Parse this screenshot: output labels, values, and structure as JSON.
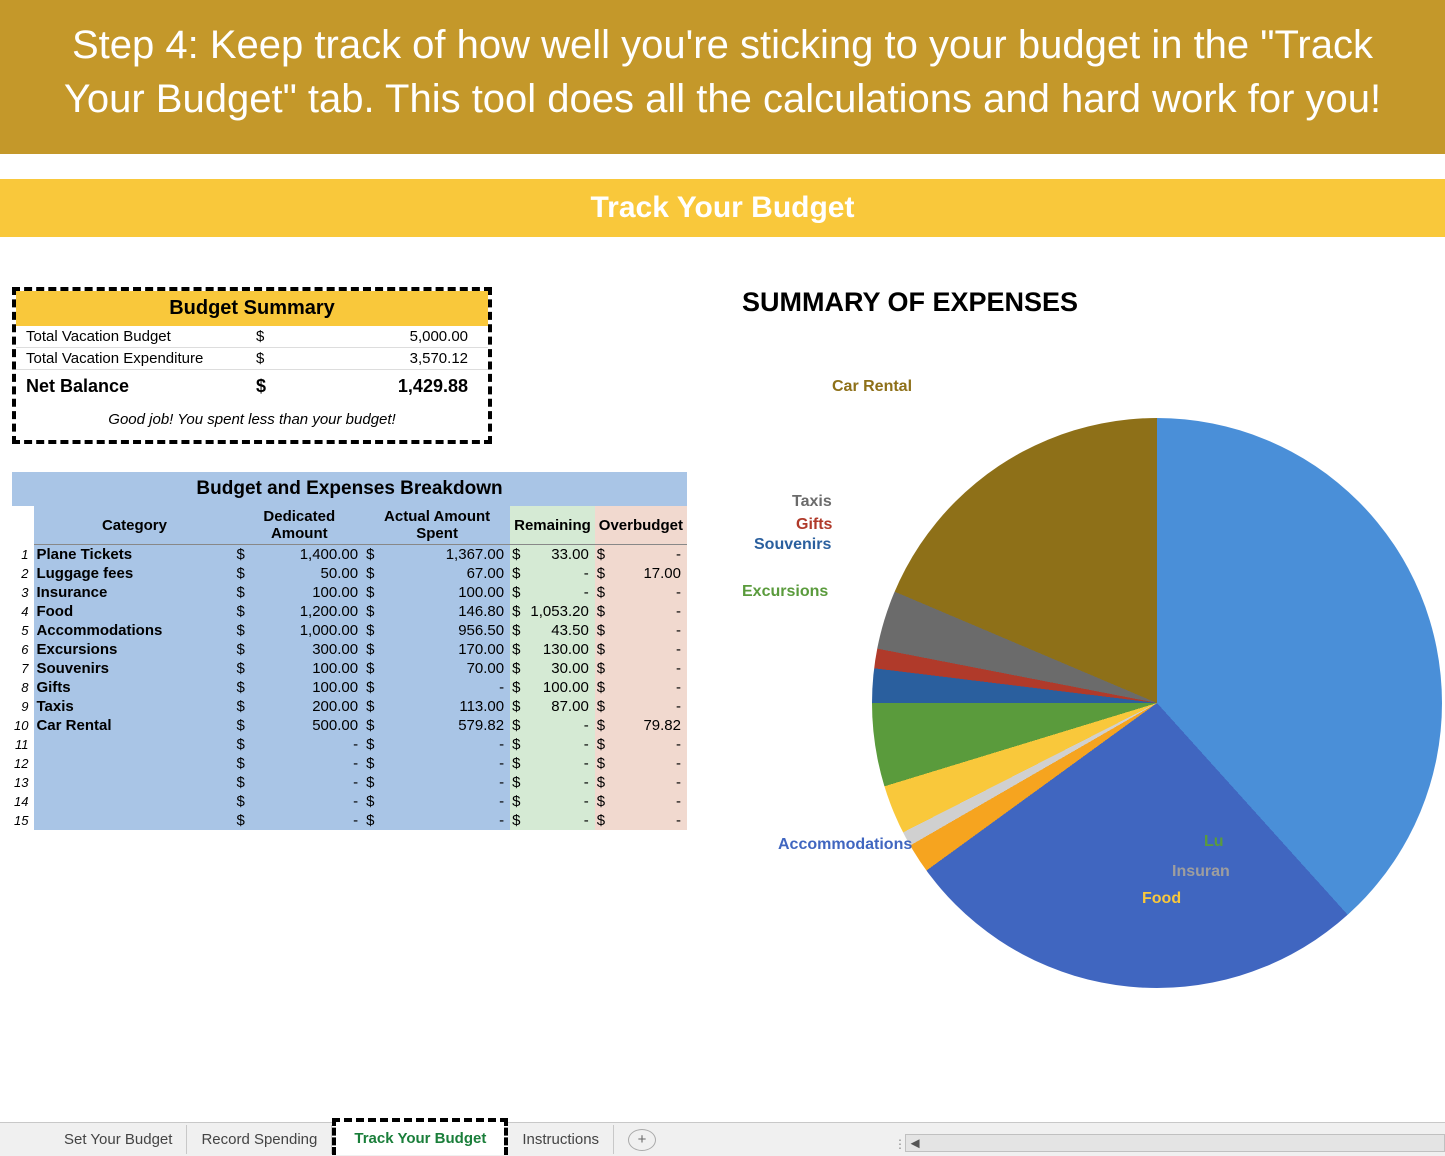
{
  "banner": "Step 4: Keep track of how well you're sticking to your budget in the \"Track Your Budget\" tab. This tool does all the calculations and hard work for you!",
  "title": "Track Your Budget",
  "summary": {
    "header": "Budget Summary",
    "rows": [
      {
        "label": "Total Vacation Budget",
        "cur": "$",
        "value": "5,000.00"
      },
      {
        "label": "Total Vacation Expenditure",
        "cur": "$",
        "value": "3,570.12"
      }
    ],
    "net": {
      "label": "Net Balance",
      "cur": "$",
      "value": "1,429.88"
    },
    "message": "Good job! You spent less than your budget!"
  },
  "breakdown": {
    "title": "Budget and Expenses Breakdown",
    "headers": {
      "category": "Category",
      "dedicated": "Dedicated Amount",
      "actual": "Actual Amount Spent",
      "remaining": "Remaining",
      "overbudget": "Overbudget"
    },
    "rows": [
      {
        "n": "1",
        "cat": "Plane Tickets",
        "ded": "1,400.00",
        "act": "1,367.00",
        "rem": "33.00",
        "over": "-"
      },
      {
        "n": "2",
        "cat": "Luggage fees",
        "ded": "50.00",
        "act": "67.00",
        "rem": "-",
        "over": "17.00"
      },
      {
        "n": "3",
        "cat": "Insurance",
        "ded": "100.00",
        "act": "100.00",
        "rem": "-",
        "over": "-"
      },
      {
        "n": "4",
        "cat": "Food",
        "ded": "1,200.00",
        "act": "146.80",
        "rem": "1,053.20",
        "over": "-"
      },
      {
        "n": "5",
        "cat": "Accommodations",
        "ded": "1,000.00",
        "act": "956.50",
        "rem": "43.50",
        "over": "-"
      },
      {
        "n": "6",
        "cat": "Excursions",
        "ded": "300.00",
        "act": "170.00",
        "rem": "130.00",
        "over": "-"
      },
      {
        "n": "7",
        "cat": "Souvenirs",
        "ded": "100.00",
        "act": "70.00",
        "rem": "30.00",
        "over": "-"
      },
      {
        "n": "8",
        "cat": "Gifts",
        "ded": "100.00",
        "act": "-",
        "rem": "100.00",
        "over": "-"
      },
      {
        "n": "9",
        "cat": "Taxis",
        "ded": "200.00",
        "act": "113.00",
        "rem": "87.00",
        "over": "-"
      },
      {
        "n": "10",
        "cat": "Car Rental",
        "ded": "500.00",
        "act": "579.82",
        "rem": "-",
        "over": "79.82"
      },
      {
        "n": "11",
        "cat": "",
        "ded": "-",
        "act": "-",
        "rem": "-",
        "over": "-"
      },
      {
        "n": "12",
        "cat": "",
        "ded": "-",
        "act": "-",
        "rem": "-",
        "over": "-"
      },
      {
        "n": "13",
        "cat": "",
        "ded": "-",
        "act": "-",
        "rem": "-",
        "over": "-"
      },
      {
        "n": "14",
        "cat": "",
        "ded": "-",
        "act": "-",
        "rem": "-",
        "over": "-"
      },
      {
        "n": "15",
        "cat": "",
        "ded": "-",
        "act": "-",
        "rem": "-",
        "over": "-"
      }
    ]
  },
  "chart": {
    "title": "SUMMARY OF EXPENSES",
    "labels": {
      "carRental": "Car Rental",
      "taxis": "Taxis",
      "gifts": "Gifts",
      "souvenirs": "Souvenirs",
      "excursions": "Excursions",
      "accommodations": "Accommodations",
      "food": "Food",
      "insurance": "Insuran",
      "luggage": "Lu"
    }
  },
  "tabs": {
    "set": "Set Your Budget",
    "record": "Record Spending",
    "track": "Track Your Budget",
    "instructions": "Instructions",
    "plus": "+"
  },
  "chart_data": {
    "type": "pie",
    "title": "SUMMARY OF EXPENSES",
    "series": [
      {
        "name": "Plane Tickets",
        "value": 1367.0,
        "color": "#4a8fd8"
      },
      {
        "name": "Accommodations",
        "value": 956.5,
        "color": "#4066c0"
      },
      {
        "name": "Food",
        "value": 146.8,
        "color": "#f9c83b"
      },
      {
        "name": "Insurance",
        "value": 100.0,
        "color": "#d0d0d0"
      },
      {
        "name": "Luggage fees",
        "value": 67.0,
        "color": "#f6a41f"
      },
      {
        "name": "Excursions",
        "value": 170.0,
        "color": "#5a9b3c"
      },
      {
        "name": "Souvenirs",
        "value": 70.0,
        "color": "#2a5f9e"
      },
      {
        "name": "Gifts",
        "value": 0.0,
        "color": "#b03a2a"
      },
      {
        "name": "Taxis",
        "value": 113.0,
        "color": "#6b6b6b"
      },
      {
        "name": "Car Rental",
        "value": 579.82,
        "color": "#8e7018"
      }
    ]
  }
}
